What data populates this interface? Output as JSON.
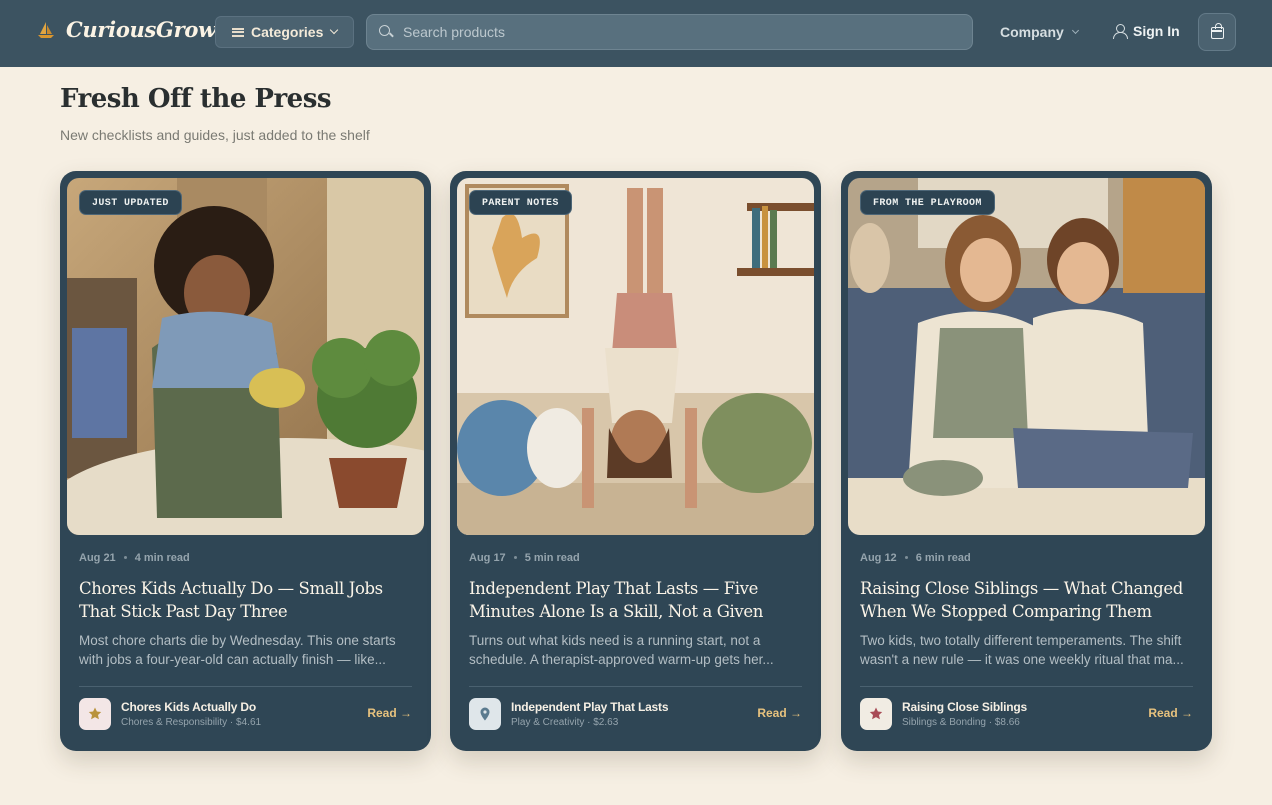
{
  "nav": {
    "logo_text": "CuriousGrow",
    "categories_label": "Categories",
    "search_placeholder": "Search products",
    "company_label": "Company",
    "signin_label": "Sign In"
  },
  "section": {
    "title": "Fresh Off the Press",
    "subtitle": "New checklists and guides, just added to the shelf"
  },
  "cards": [
    {
      "tag": "JUST UPDATED",
      "date": "Aug 21",
      "read_time": "4 min read",
      "title": "Chores Kids Actually Do — Small Jobs That Stick Past Day Three",
      "description": "Most chore charts die by Wednesday. This one starts with jobs a four-year-old can actually finish — like...",
      "product_name": "Chores Kids Actually Do",
      "product_meta": "Chores & Responsibility · $4.61",
      "read_label": "Read →",
      "icon": "star-icon",
      "icon_color": "#b9933c",
      "thumb_bg": "#f3e6e6"
    },
    {
      "tag": "PARENT NOTES",
      "date": "Aug 17",
      "read_time": "5 min read",
      "title": "Independent Play That Lasts — Five Minutes Alone Is a Skill, Not a Given",
      "description": "Turns out what kids need is a running start, not a schedule. A therapist-approved warm-up gets her...",
      "product_name": "Independent Play That Lasts",
      "product_meta": "Play & Creativity · $2.63",
      "read_label": "Read →",
      "icon": "map-pin-icon",
      "icon_color": "#5b7b8f",
      "thumb_bg": "#dfe6ea"
    },
    {
      "tag": "FROM THE PLAYROOM",
      "date": "Aug 12",
      "read_time": "6 min read",
      "title": "Raising Close Siblings — What Changed When We Stopped Comparing Them",
      "description": "Two kids, two totally different temperaments. The shift wasn't a new rule — it was one weekly ritual that ma...",
      "product_name": "Raising Close Siblings",
      "product_meta": "Siblings & Bonding · $8.66",
      "read_label": "Read →",
      "icon": "star-icon",
      "icon_color": "#a84a55",
      "thumb_bg": "#f1ece3"
    }
  ]
}
